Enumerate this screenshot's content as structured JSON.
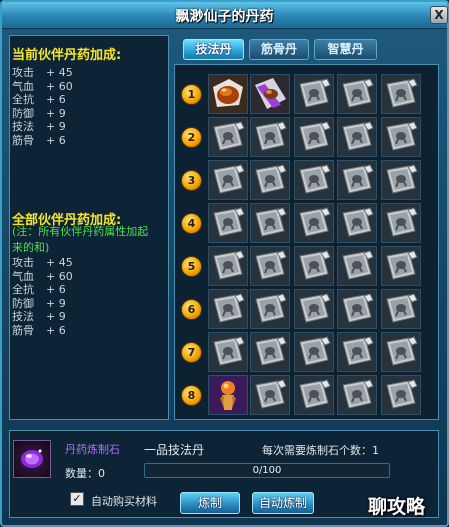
{
  "window": {
    "title": "飘渺仙子的丹药",
    "close_label": "X"
  },
  "left_panel": {
    "current_title": "当前伙伴丹药加成:",
    "current_stats": [
      {
        "name": "攻击",
        "value": "+ 45"
      },
      {
        "name": "气血",
        "value": "+ 60"
      },
      {
        "name": "全抗",
        "value": "+ 6"
      },
      {
        "name": "防御",
        "value": "+ 9"
      },
      {
        "name": "技法",
        "value": "+ 9"
      },
      {
        "name": "筋骨",
        "value": "+ 6"
      }
    ],
    "all_title": "全部伙伴丹药加成:",
    "all_note": "(注：所有伙伴丹药属性加起来的和)",
    "all_stats": [
      {
        "name": "攻击",
        "value": "+ 45"
      },
      {
        "name": "气血",
        "value": "+ 60"
      },
      {
        "name": "全抗",
        "value": "+ 6"
      },
      {
        "name": "防御",
        "value": "+ 9"
      },
      {
        "name": "技法",
        "value": "+ 9"
      },
      {
        "name": "筋骨",
        "value": "+ 6"
      }
    ]
  },
  "tabs": [
    {
      "label": "技法丹",
      "active": true
    },
    {
      "label": "筋骨丹",
      "active": false
    },
    {
      "label": "智慧丹",
      "active": false
    }
  ],
  "grid": {
    "row_numbers": [
      "1",
      "2",
      "3",
      "4",
      "5",
      "6",
      "7",
      "8"
    ],
    "slots": [
      [
        "pill-orange-icon",
        "pill-purple-icon",
        "locked-scroll-icon",
        "locked-scroll-icon",
        "locked-scroll-icon"
      ],
      [
        "locked-scroll-icon",
        "locked-scroll-icon",
        "locked-scroll-icon",
        "locked-scroll-icon",
        "locked-scroll-icon"
      ],
      [
        "locked-scroll-icon",
        "locked-scroll-icon",
        "locked-scroll-icon",
        "locked-scroll-icon",
        "locked-scroll-icon"
      ],
      [
        "locked-scroll-icon",
        "locked-scroll-icon",
        "locked-scroll-icon",
        "locked-scroll-icon",
        "locked-scroll-icon"
      ],
      [
        "locked-scroll-icon",
        "locked-scroll-icon",
        "locked-scroll-icon",
        "locked-scroll-icon",
        "locked-scroll-icon"
      ],
      [
        "locked-scroll-icon",
        "locked-scroll-icon",
        "locked-scroll-icon",
        "locked-scroll-icon",
        "locked-scroll-icon"
      ],
      [
        "locked-scroll-icon",
        "locked-scroll-icon",
        "locked-scroll-icon",
        "locked-scroll-icon",
        "locked-scroll-icon"
      ],
      [
        "figure-icon",
        "locked-scroll-icon",
        "locked-scroll-icon",
        "locked-scroll-icon",
        "locked-scroll-icon"
      ]
    ]
  },
  "bottom": {
    "item_name": "丹药炼制石",
    "item_icon": "purple-gem-icon",
    "recipe": "一品技法丹",
    "required_text": "每次需要炼制石个数：1",
    "quantity_text": "数量：0",
    "progress_text": "0/100",
    "progress_value": 0,
    "auto_buy_label": "自动购买材料",
    "auto_buy_checked": true,
    "refine_label": "炼制",
    "auto_refine_label": "自动炼制"
  },
  "watermark": "聊攻略",
  "colors": {
    "title_gold": "#f5e52a",
    "note_green": "#4fe04f",
    "item_purple": "#b46cff",
    "accent_blue": "#3aa0c8"
  }
}
